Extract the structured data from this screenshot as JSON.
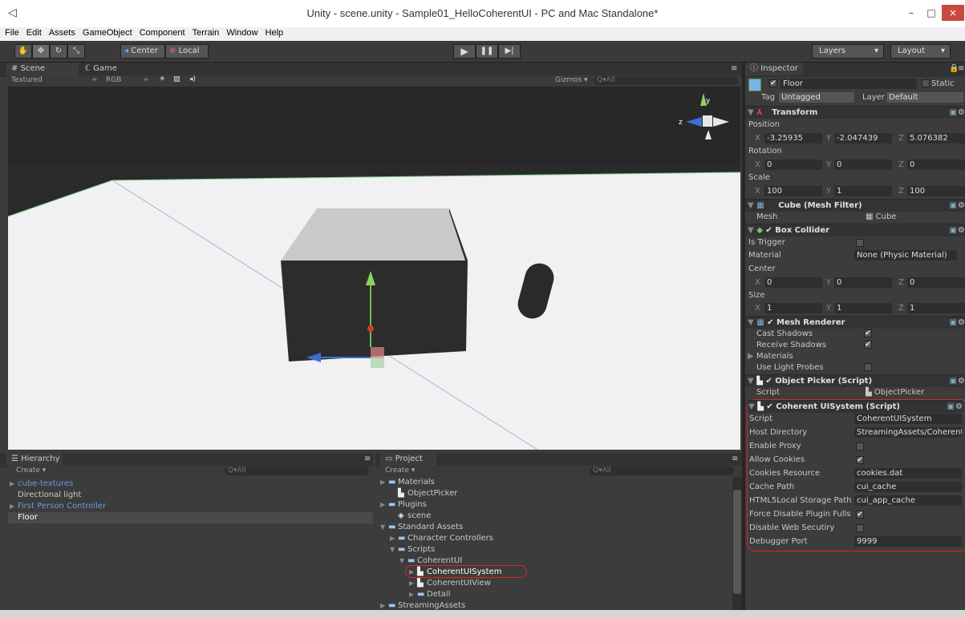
{
  "window": {
    "title": "Unity - scene.unity - Sample01_HelloCoherentUI - PC and Mac Standalone*",
    "min": "–",
    "max": "□",
    "close": "×"
  },
  "menu": [
    "File",
    "Edit",
    "Assets",
    "GameObject",
    "Component",
    "Terrain",
    "Window",
    "Help"
  ],
  "toolbar": {
    "center": "Center",
    "local": "Local",
    "play": "▶",
    "pause": "❚❚",
    "step": "▶|",
    "layers": "Layers",
    "layout": "Layout"
  },
  "scene": {
    "tab_scene": "Scene",
    "tab_game": "Game",
    "render_mode": "Textured",
    "color_mode": "RGB",
    "gizmos": "Gizmos",
    "search": "All",
    "axis_y": "y",
    "axis_z": "z"
  },
  "hierarchy": {
    "tab": "Hierarchy",
    "create": "Create",
    "search": "All",
    "items": [
      {
        "label": "cube-textures",
        "color": "#6a9ad8",
        "arrow": "▶"
      },
      {
        "label": "Directional light",
        "color": "#c8c8c8",
        "arrow": ""
      },
      {
        "label": "First Person Controller",
        "color": "#6a9ad8",
        "arrow": "▶"
      },
      {
        "label": "Floor",
        "color": "#ffffff",
        "arrow": ""
      }
    ]
  },
  "project": {
    "tab": "Project",
    "create": "Create",
    "search": "All",
    "items": [
      {
        "label": "Materials",
        "depth": 0,
        "arrow": "▶",
        "kind": "folder"
      },
      {
        "label": "ObjectPicker",
        "depth": 1,
        "arrow": "",
        "kind": "script"
      },
      {
        "label": "Plugins",
        "depth": 0,
        "arrow": "▶",
        "kind": "folder"
      },
      {
        "label": "scene",
        "depth": 1,
        "arrow": "",
        "kind": "scene"
      },
      {
        "label": "Standard Assets",
        "depth": 0,
        "arrow": "▼",
        "kind": "folder"
      },
      {
        "label": "Character Controllers",
        "depth": 1,
        "arrow": "▶",
        "kind": "folder"
      },
      {
        "label": "Scripts",
        "depth": 1,
        "arrow": "▼",
        "kind": "folder"
      },
      {
        "label": "CoherentUI",
        "depth": 2,
        "arrow": "▼",
        "kind": "folder"
      },
      {
        "label": "CoherentUISystem",
        "depth": 3,
        "arrow": "▶",
        "kind": "script",
        "highlight": true
      },
      {
        "label": "CoherentUIView",
        "depth": 3,
        "arrow": "▶",
        "kind": "script"
      },
      {
        "label": "Detail",
        "depth": 3,
        "arrow": "▶",
        "kind": "folder"
      },
      {
        "label": "StreamingAssets",
        "depth": 0,
        "arrow": "▶",
        "kind": "folder"
      }
    ]
  },
  "inspector": {
    "tab": "Inspector",
    "object_name": "Floor",
    "static": "Static",
    "tag_label": "Tag",
    "tag": "Untagged",
    "layer_label": "Layer",
    "layer": "Default",
    "transform": {
      "title": "Transform",
      "position": "Position",
      "rotation": "Rotation",
      "scale": "Scale",
      "pos": [
        "-3.25935",
        "-2.047439",
        "5.076382"
      ],
      "rot": [
        "0",
        "0",
        "0"
      ],
      "scl": [
        "100",
        "1",
        "100"
      ]
    },
    "mesh_filter": {
      "title": "Cube (Mesh Filter)",
      "mesh_label": "Mesh",
      "mesh": "Cube"
    },
    "box_collider": {
      "title": "Box Collider",
      "is_trigger": "Is Trigger",
      "material_label": "Material",
      "material": "None (Physic Material)",
      "center": "Center",
      "center_v": [
        "0",
        "0",
        "0"
      ],
      "size": "Size",
      "size_v": [
        "1",
        "1",
        "1"
      ]
    },
    "mesh_renderer": {
      "title": "Mesh Renderer",
      "cast": "Cast Shadows",
      "receive": "Receive Shadows",
      "materials": "Materials",
      "light_probes": "Use Light Probes"
    },
    "object_picker": {
      "title": "Object Picker (Script)",
      "script_label": "Script",
      "script": "ObjectPicker"
    },
    "cui": {
      "title": "Coherent UISystem (Script)",
      "rows": [
        {
          "label": "Script",
          "value": "CoherentUISystem",
          "type": "field"
        },
        {
          "label": "Host Directory",
          "value": "StreamingAssets/CoherentU",
          "type": "field"
        },
        {
          "label": "Enable Proxy",
          "value": "",
          "type": "check"
        },
        {
          "label": "Allow Cookies",
          "value": "✔",
          "type": "check"
        },
        {
          "label": "Cookies Resource",
          "value": "cookies.dat",
          "type": "field"
        },
        {
          "label": "Cache Path",
          "value": "cui_cache",
          "type": "field"
        },
        {
          "label": "HTML5Local Storage Path",
          "value": "cui_app_cache",
          "type": "field"
        },
        {
          "label": "Force Disable Plugin Fulls",
          "value": "✔",
          "type": "check"
        },
        {
          "label": "Disable Web Secutiry",
          "value": "",
          "type": "check"
        },
        {
          "label": "Debugger Port",
          "value": "9999",
          "type": "field"
        }
      ]
    }
  }
}
